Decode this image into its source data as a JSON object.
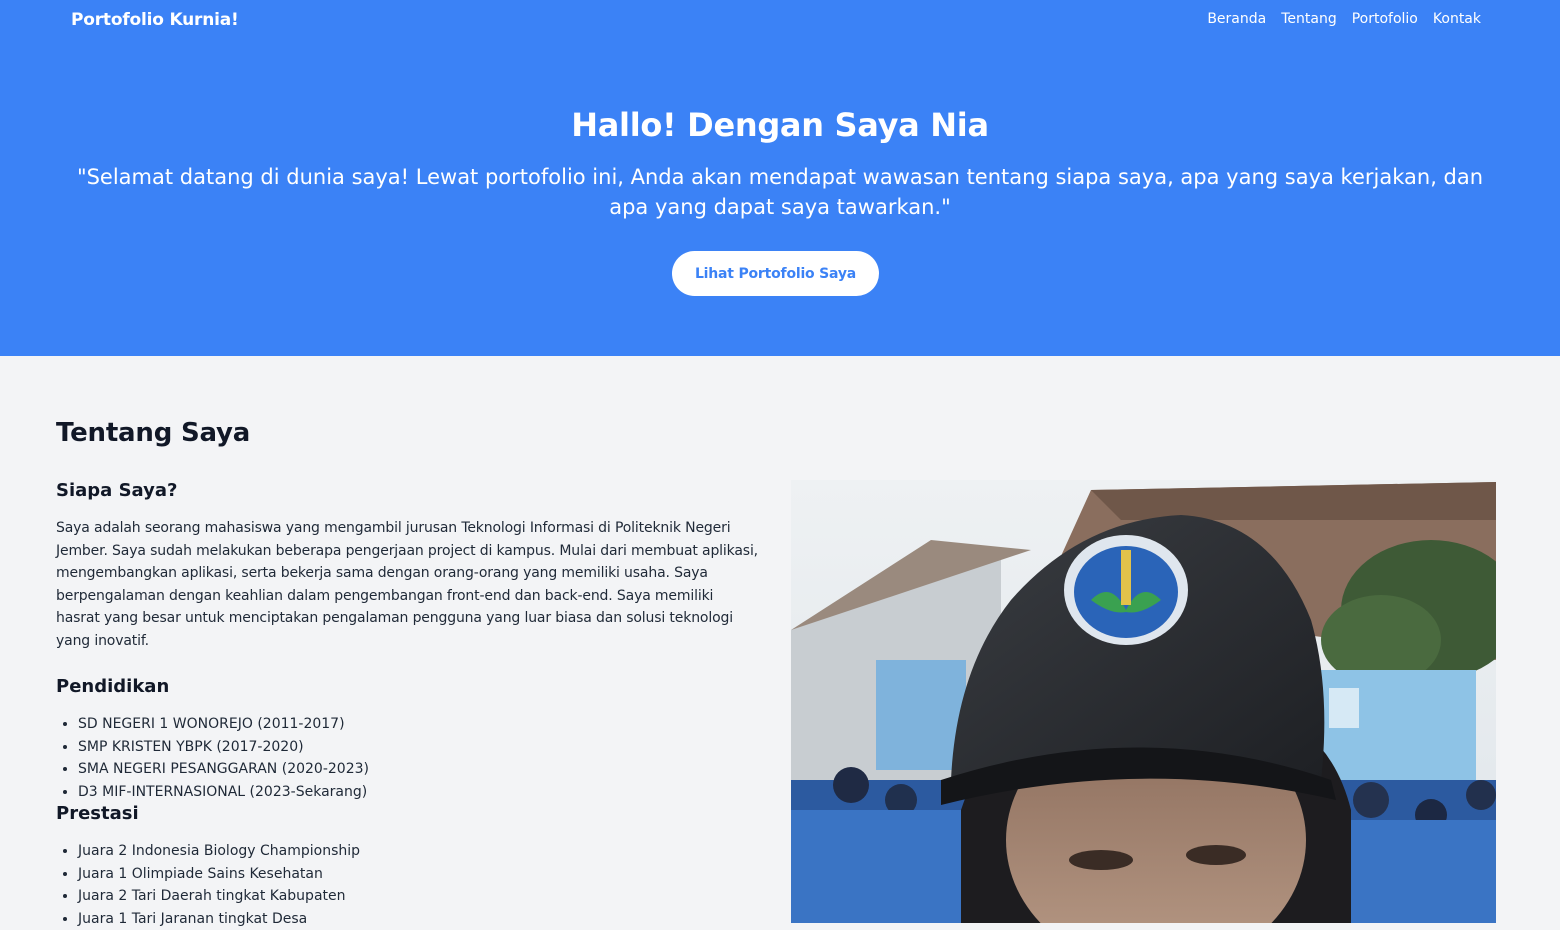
{
  "header": {
    "brand": "Portofolio Kurnia!",
    "nav": [
      {
        "label": "Beranda"
      },
      {
        "label": "Tentang"
      },
      {
        "label": "Portofolio"
      },
      {
        "label": "Kontak"
      }
    ]
  },
  "hero": {
    "title": "Hallo! Dengan Saya Nia",
    "subtitle": "\"Selamat datang di dunia saya! Lewat portofolio ini, Anda akan mendapat wawasan tentang siapa saya, apa yang saya kerjakan, dan apa yang dapat saya tawarkan.\"",
    "button_label": "Lihat Portofolio Saya"
  },
  "about": {
    "title": "Tentang Saya",
    "who_heading": "Siapa Saya?",
    "bio": "Saya adalah seorang mahasiswa yang mengambil jurusan Teknologi Informasi di Politeknik Negeri Jember. Saya sudah melakukan beberapa pengerjaan project di kampus. Mulai dari membuat aplikasi, mengembangkan aplikasi, serta bekerja sama dengan orang-orang yang memiliki usaha. Saya berpengalaman dengan keahlian dalam pengembangan front-end dan back-end. Saya memiliki hasrat yang besar untuk menciptakan pengalaman pengguna yang luar biasa dan solusi teknologi yang inovatif.",
    "education_heading": "Pendidikan",
    "education": [
      "SD NEGERI 1 WONOREJO (2011-2017)",
      "SMP KRISTEN YBPK (2017-2020)",
      "SMA NEGERI PESANGGARAN (2020-2023)",
      "D3 MIF-INTERNASIONAL (2023-Sekarang)"
    ],
    "achievements_heading": "Prestasi",
    "achievements": [
      "Juara 2 Indonesia Biology Championship",
      "Juara 1 Olimpiade Sains Kesehatan",
      "Juara 2 Tari Daerah tingkat Kabupaten",
      "Juara 1 Tari Jaranan tingkat Desa"
    ]
  },
  "colors": {
    "primary": "#3b82f6",
    "background": "#f3f4f6",
    "text": "#111827"
  }
}
